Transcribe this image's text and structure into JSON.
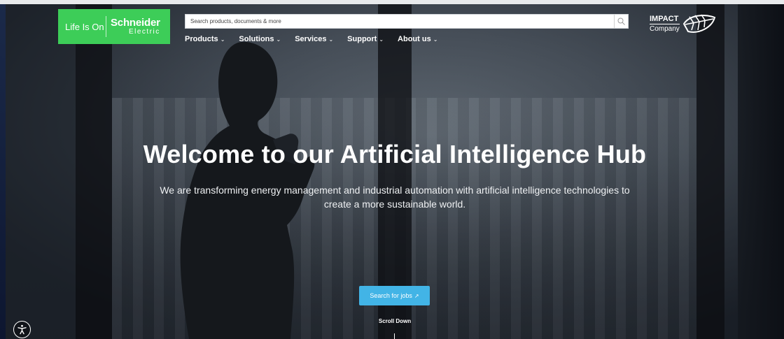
{
  "brand": {
    "tagline": "Life Is On",
    "name": "Schneider",
    "sub": "Electric",
    "color": "#3dcd58"
  },
  "search": {
    "placeholder": "Search products, documents & more",
    "icon": "search-icon"
  },
  "nav": {
    "items": [
      {
        "label": "Products"
      },
      {
        "label": "Solutions"
      },
      {
        "label": "Services"
      },
      {
        "label": "Support"
      },
      {
        "label": "About us"
      }
    ]
  },
  "impact": {
    "title": "IMPACT",
    "subtitle": "Company",
    "icon": "leaf-icon"
  },
  "hero": {
    "title": "Welcome to our Artificial Intelligence Hub",
    "subtitle": "We are transforming energy management and industrial automation with artificial intelligence technologies to create a more sustainable world."
  },
  "cta": {
    "label": "Search for jobs",
    "icon": "external-link-icon",
    "color": "#42b4e6"
  },
  "scroll": {
    "label": "Scroll Down"
  },
  "accessibility": {
    "icon": "accessibility-icon"
  }
}
